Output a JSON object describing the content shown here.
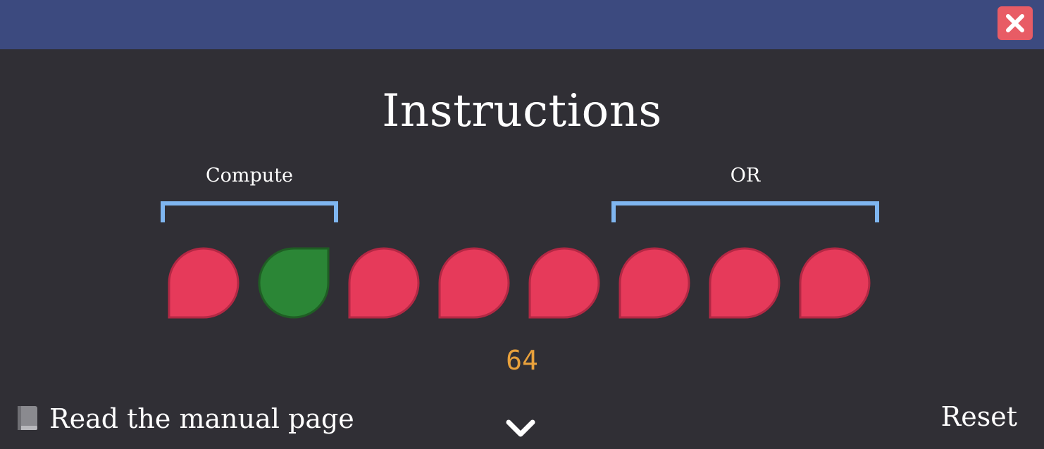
{
  "window": {
    "close_icon": "close-icon"
  },
  "title": "Instructions",
  "brackets": [
    {
      "label": "Compute"
    },
    {
      "label": "OR"
    }
  ],
  "bits": [
    {
      "state": "off",
      "color": "#e63a5a"
    },
    {
      "state": "on",
      "color": "#2b8636"
    },
    {
      "state": "off",
      "color": "#e63a5a"
    },
    {
      "state": "off",
      "color": "#e63a5a"
    },
    {
      "state": "off",
      "color": "#e63a5a"
    },
    {
      "state": "off",
      "color": "#e63a5a"
    },
    {
      "state": "off",
      "color": "#e63a5a"
    },
    {
      "state": "off",
      "color": "#e63a5a"
    }
  ],
  "value": "64",
  "footer": {
    "manual_label": "Read the manual page",
    "manual_icon": "book-icon",
    "expand_icon": "chevron-down-icon",
    "reset_label": "Reset"
  },
  "colors": {
    "titlebar": "#3c4a7f",
    "background": "#302f35",
    "bracket": "#7fb6f0",
    "value": "#e8a13c",
    "close": "#e85c65"
  }
}
